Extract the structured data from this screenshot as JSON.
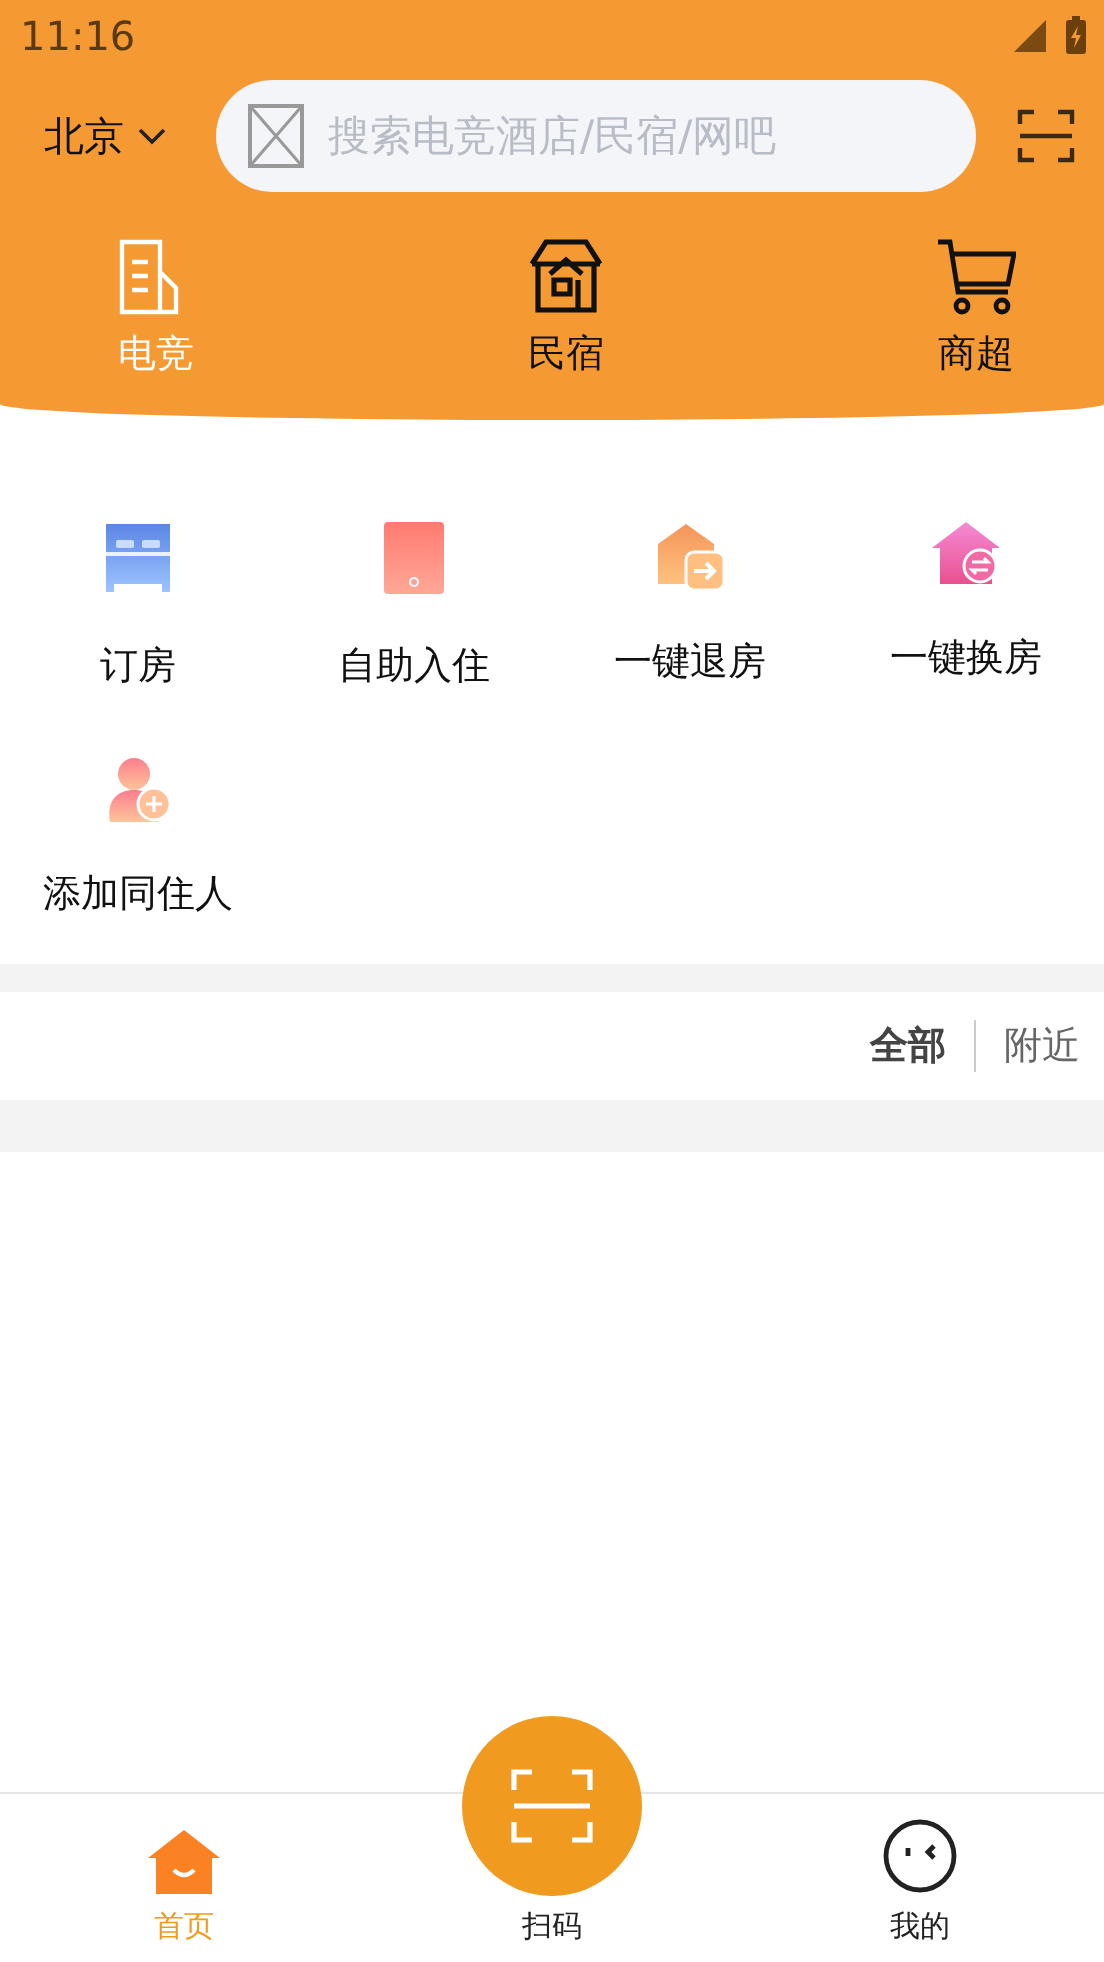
{
  "status_bar": {
    "time": "11:16"
  },
  "header": {
    "city": "北京",
    "search": {
      "placeholder": "搜索电竞酒店/民宿/网吧"
    },
    "categories": [
      {
        "label": "电竞",
        "kind": "building",
        "selected": true
      },
      {
        "label": "民宿",
        "kind": "house",
        "selected": false
      },
      {
        "label": "商超",
        "kind": "cart",
        "selected": false
      }
    ]
  },
  "services": [
    {
      "label": "订房",
      "kind": "bed"
    },
    {
      "label": "自助入住",
      "kind": "tablet"
    },
    {
      "label": "一键退房",
      "kind": "checkout"
    },
    {
      "label": "一键换房",
      "kind": "swap"
    },
    {
      "label": "添加同住人",
      "kind": "adduser"
    }
  ],
  "filters": [
    {
      "label": "全部",
      "selected": true
    },
    {
      "label": "附近",
      "selected": false
    }
  ],
  "bottom_nav": [
    {
      "label": "首页",
      "kind": "home",
      "selected": true
    },
    {
      "label": "扫码",
      "kind": "scan",
      "selected": false
    },
    {
      "label": "我的",
      "kind": "profile",
      "selected": false
    }
  ]
}
